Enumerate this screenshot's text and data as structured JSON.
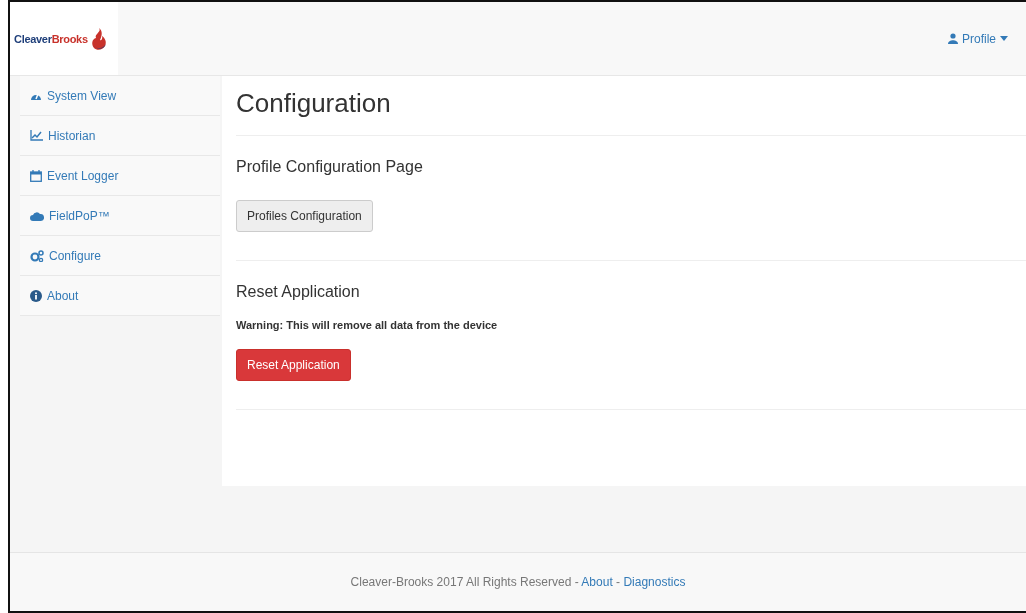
{
  "header": {
    "logo": {
      "text_1": "Cleaver",
      "text_2": "Brooks"
    },
    "profile_menu": {
      "label": "Profile"
    }
  },
  "sidebar": {
    "items": [
      {
        "label": "System View"
      },
      {
        "label": "Historian"
      },
      {
        "label": "Event Logger"
      },
      {
        "label": "FieldPoP™"
      },
      {
        "label": "Configure"
      },
      {
        "label": "About"
      }
    ]
  },
  "main": {
    "title": "Configuration",
    "sections": [
      {
        "heading": "Profile Configuration Page",
        "button": {
          "label": "Profiles Configuration",
          "kind": "default"
        }
      },
      {
        "heading": "Reset Application",
        "warning": "Warning: This will remove all data from the device",
        "button": {
          "label": "Reset Application",
          "kind": "danger"
        }
      }
    ]
  },
  "footer": {
    "text": "Cleaver-Brooks 2017 All Rights Reserved",
    "separator": "-",
    "links": [
      "About",
      "Diagnostics"
    ]
  }
}
